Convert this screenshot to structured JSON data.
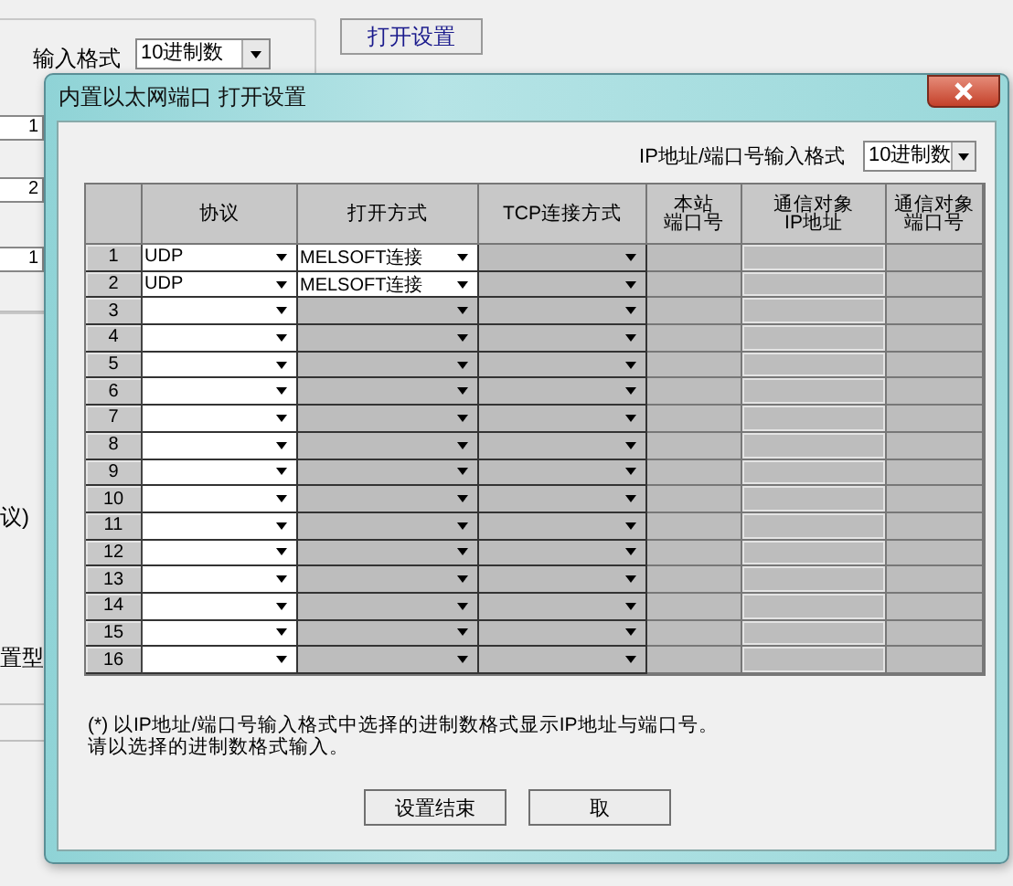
{
  "background": {
    "format_label": "输入格式",
    "format_select": "10进制数",
    "open_button": "打开设置",
    "fields": [
      "1",
      "2",
      "1"
    ],
    "labels": [
      "议)",
      "置型"
    ]
  },
  "dialog": {
    "title": "内置以太网端口 打开设置",
    "format_label": "IP地址/端口号输入格式",
    "format_select": "10进制数",
    "columns": [
      [],
      [
        "协议"
      ],
      [
        "打开方式"
      ],
      [
        "TCP连接方式"
      ],
      [
        "本站",
        "端口号"
      ],
      [
        "通信对象",
        "IP地址"
      ],
      [
        "通信对象",
        "端口号"
      ]
    ],
    "rows": [
      {
        "no": "1",
        "protocol": "UDP",
        "open_method": "MELSOFT连接",
        "open_enabled": true
      },
      {
        "no": "2",
        "protocol": "UDP",
        "open_method": "MELSOFT连接",
        "open_enabled": true
      },
      {
        "no": "3",
        "open_enabled": false
      },
      {
        "no": "4",
        "open_enabled": false
      },
      {
        "no": "5",
        "open_enabled": false
      },
      {
        "no": "6",
        "open_enabled": false
      },
      {
        "no": "7",
        "open_enabled": false
      },
      {
        "no": "8",
        "open_enabled": false
      },
      {
        "no": "9",
        "open_enabled": false
      },
      {
        "no": "10",
        "open_enabled": false
      },
      {
        "no": "11",
        "open_enabled": false
      },
      {
        "no": "12",
        "open_enabled": false
      },
      {
        "no": "13",
        "open_enabled": false
      },
      {
        "no": "14",
        "open_enabled": false
      },
      {
        "no": "15",
        "open_enabled": false
      },
      {
        "no": "16",
        "open_enabled": false
      }
    ],
    "note": [
      "(*) 以IP地址/端口号输入格式中选择的进制数格式显示IP地址与端口号。",
      "请以选择的进制数格式输入。"
    ],
    "buttons": [
      "设置结束",
      "取"
    ]
  }
}
